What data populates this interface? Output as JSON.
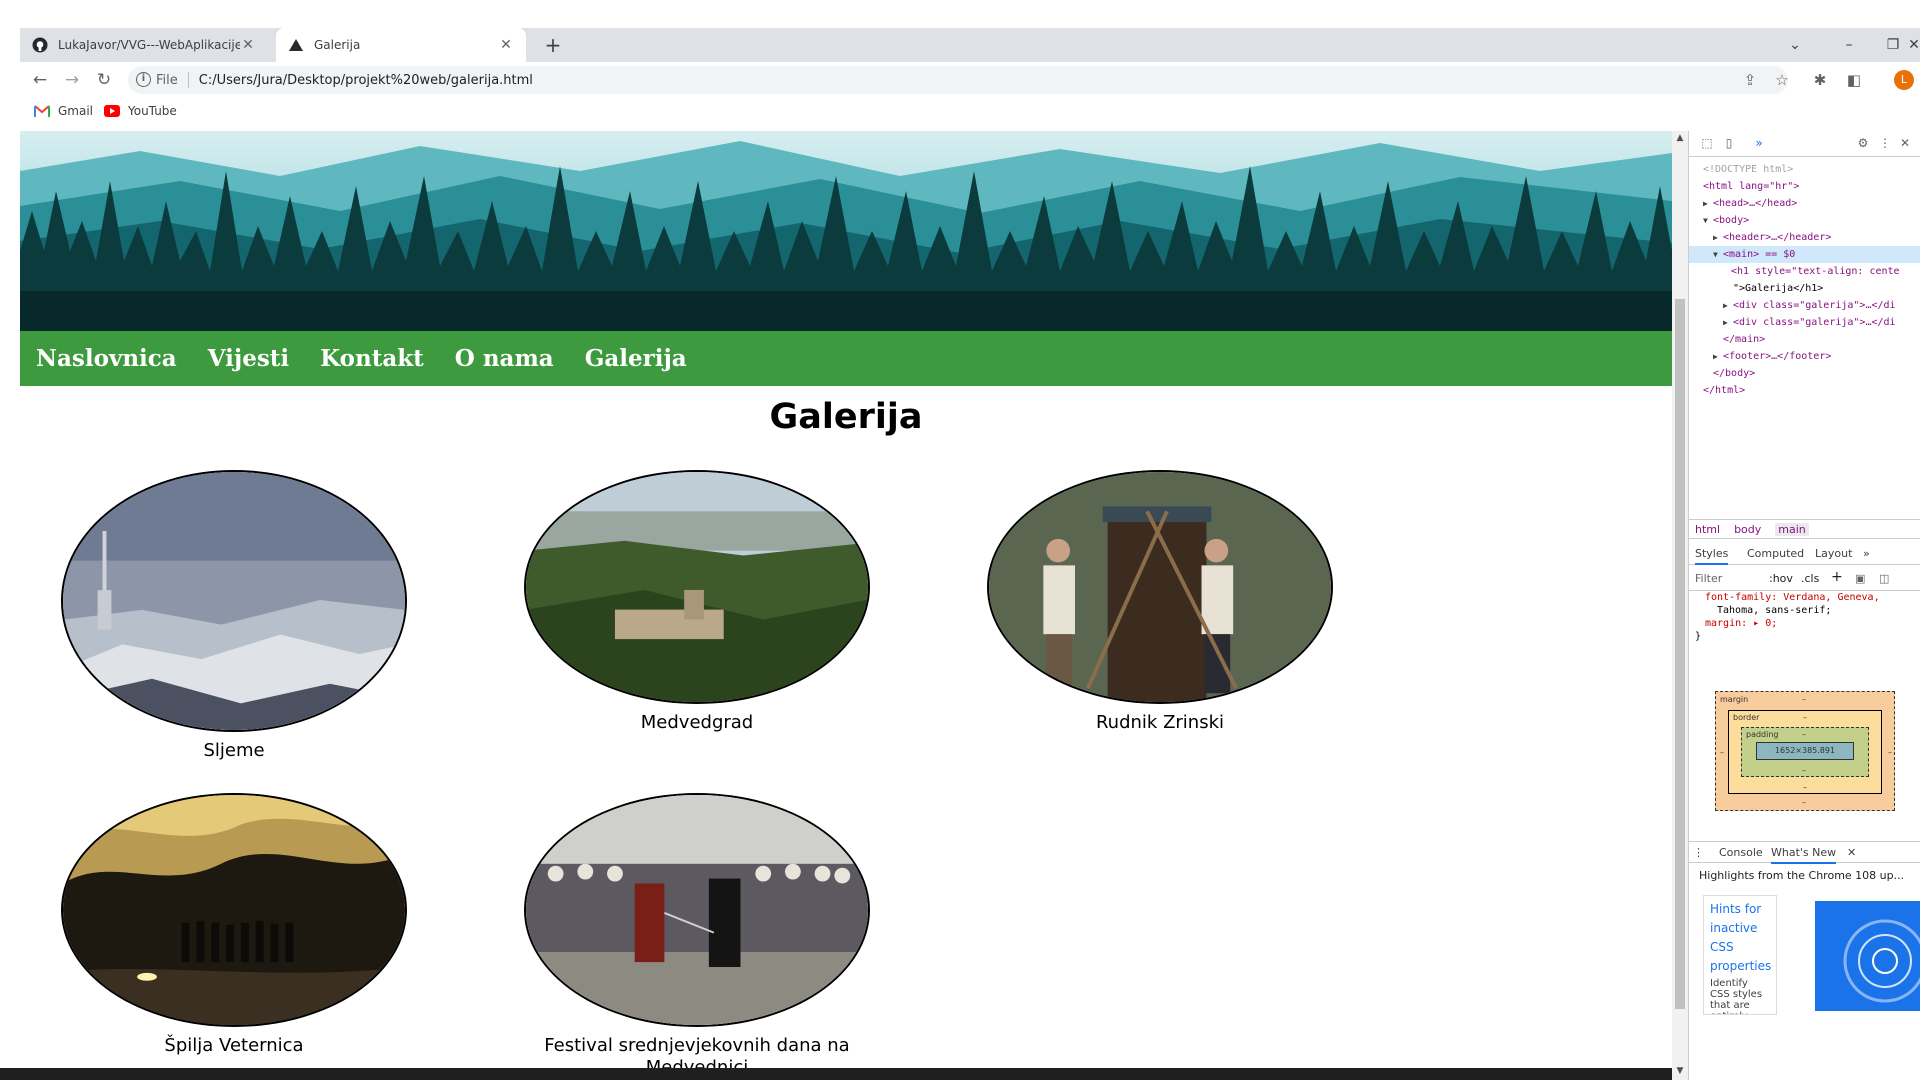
{
  "browser": {
    "tabs": [
      {
        "title": "LukaJavor/VVG---WebAplikacije",
        "icon": "github-icon",
        "active": false
      },
      {
        "title": "Galerija",
        "icon": "triangle-page-icon",
        "active": true
      }
    ],
    "new_tab_symbol": "+",
    "address": {
      "scheme": "File",
      "url": "C:/Users/Jura/Desktop/projekt%20web/galerija.html"
    },
    "profile_initial": "L",
    "bookmarks": [
      {
        "label": "Gmail",
        "icon": "gmail-icon"
      },
      {
        "label": "YouTube",
        "icon": "youtube-icon"
      }
    ]
  },
  "page": {
    "nav": [
      "Naslovnica",
      "Vijesti",
      "Kontakt",
      "O nama",
      "Galerija"
    ],
    "title": "Galerija",
    "gallery": [
      {
        "caption": "Sljeme"
      },
      {
        "caption": "Medvedgrad"
      },
      {
        "caption": "Rudnik Zrinski"
      },
      {
        "caption": "Špilja Veternica"
      },
      {
        "caption": "Festival srednjevjekovnih dana na Medvednici"
      }
    ],
    "colors": {
      "nav": "#3e9a3e",
      "banner_sky": "#a8dde0",
      "banner_forest": "#0b3b3c"
    }
  },
  "devtools": {
    "dom_lines": {
      "doctype": "<!DOCTYPE html>",
      "html_open": "<html lang=\"hr\">",
      "head": "<head>…</head>",
      "body_open": "<body>",
      "header": "<header>…</header>",
      "main_open": "<main> == $0",
      "h1_line1": "<h1 style=\"text-align: cente",
      "h1_line2": "\">Galerija</h1>",
      "div1": "<div class=\"galerija\">…</di",
      "div2": "<div class=\"galerija\">…</di",
      "main_close": "</main>",
      "footer": "<footer>…</footer>",
      "body_close": "</body>",
      "html_close": "</html>"
    },
    "breadcrumbs": [
      "html",
      "body",
      "main"
    ],
    "style_tabs": [
      "Styles",
      "Computed",
      "Layout",
      "»"
    ],
    "filter": {
      "placeholder": "Filter",
      "hov": ":hov",
      "cls": ".cls",
      "plus": "+"
    },
    "css": {
      "line1": "font-family: Verdana, Geneva,",
      "line2": "Tahoma, sans-serif;",
      "line3": "margin: ▸ 0;",
      "line4": "}"
    },
    "box_model": {
      "margin": "margin",
      "border": "border",
      "padding": "padding",
      "content": "1652×385.891",
      "dash": "–"
    },
    "drawer_tabs": [
      "Console",
      "What's New"
    ],
    "whats_new": "Highlights from the Chrome 108 up...",
    "hint_title": "Hints for inactive CSS properties",
    "hint_desc": "Identify CSS styles that are entirely"
  }
}
